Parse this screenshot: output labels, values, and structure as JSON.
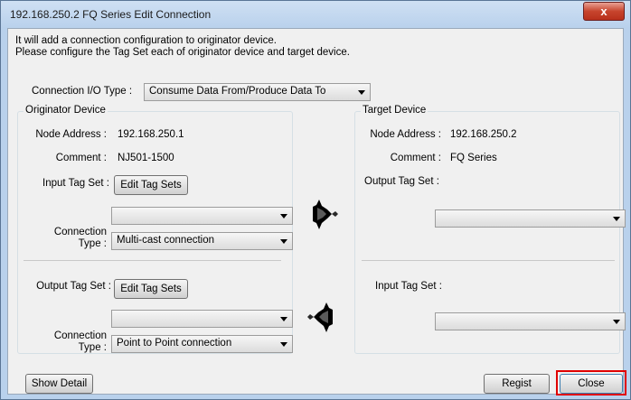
{
  "window": {
    "title": "192.168.250.2 FQ Series Edit Connection",
    "close_glyph": "x"
  },
  "intro": {
    "line1": "It will add a connection configuration to originator device.",
    "line2": "Please configure the Tag Set each of originator device and target device."
  },
  "connection_io": {
    "label": "Connection I/O Type :",
    "value": "Consume Data From/Produce Data To"
  },
  "originator": {
    "title": "Originator Device",
    "node_label": "Node Address :",
    "node_value": "192.168.250.1",
    "comment_label": "Comment :",
    "comment_value": "NJ501-1500",
    "input_tag_label": "Input Tag Set :",
    "input_edit_button": "Edit Tag Sets",
    "input_tag_value": "",
    "conn_type_label_1": "Connection",
    "conn_type_label_2": "Type :",
    "input_conn_type": "Multi-cast connection",
    "output_tag_label": "Output Tag Set :",
    "output_edit_button": "Edit Tag Sets",
    "output_tag_value": "",
    "output_conn_type": "Point to Point connection"
  },
  "target": {
    "title": "Target Device",
    "node_label": "Node Address :",
    "node_value": "192.168.250.2",
    "comment_label": "Comment :",
    "comment_value": "FQ Series",
    "output_tag_label": "Output Tag Set :",
    "output_tag_value": "",
    "input_tag_label": "Input Tag Set :",
    "input_tag_value": ""
  },
  "buttons": {
    "show_detail": "Show Detail",
    "regist": "Regist",
    "close": "Close"
  },
  "colors": {
    "highlight": "#e00000",
    "arrow": "#000000"
  }
}
